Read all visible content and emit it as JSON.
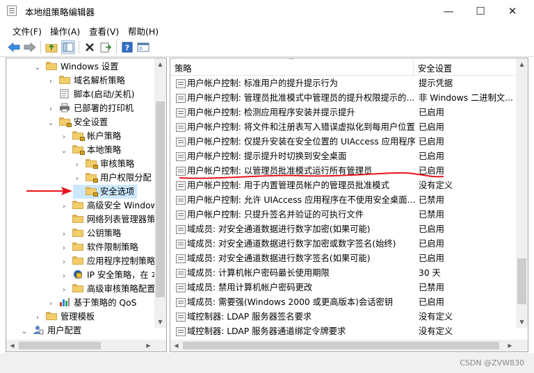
{
  "window": {
    "title": "本地组策略编辑器",
    "min": "—",
    "max": "☐",
    "close": "✕"
  },
  "menu": [
    "文件(F)",
    "操作(A)",
    "查看(V)",
    "帮助(H)"
  ],
  "tree": [
    {
      "label": "Windows 设置",
      "level": 1,
      "toggle": "⌄",
      "icon": "folder"
    },
    {
      "label": "域名解析策略",
      "level": 2,
      "toggle": "›",
      "icon": "folder"
    },
    {
      "label": "脚本(启动/关机)",
      "level": 2,
      "toggle": "",
      "icon": "script"
    },
    {
      "label": "已部署的打印机",
      "level": 2,
      "toggle": "›",
      "icon": "printer"
    },
    {
      "label": "安全设置",
      "level": 2,
      "toggle": "⌄",
      "icon": "folder-lock"
    },
    {
      "label": "帐户策略",
      "level": 3,
      "toggle": "›",
      "icon": "folder-lock"
    },
    {
      "label": "本地策略",
      "level": 3,
      "toggle": "⌄",
      "icon": "folder-lock"
    },
    {
      "label": "审核策略",
      "level": 4,
      "toggle": "›",
      "icon": "folder-lock"
    },
    {
      "label": "用户权限分配",
      "level": 4,
      "toggle": "›",
      "icon": "folder-lock"
    },
    {
      "label": "安全选项",
      "level": 4,
      "toggle": "",
      "icon": "folder-lock",
      "selected": true
    },
    {
      "label": "高级安全 Windows Defender 防火墙",
      "level": 3,
      "toggle": "›",
      "icon": "folder"
    },
    {
      "label": "网络列表管理器策略",
      "level": 3,
      "toggle": "",
      "icon": "folder"
    },
    {
      "label": "公钥策略",
      "level": 3,
      "toggle": "›",
      "icon": "folder"
    },
    {
      "label": "软件限制策略",
      "level": 3,
      "toggle": "›",
      "icon": "folder"
    },
    {
      "label": "应用程序控制策略",
      "level": 3,
      "toggle": "›",
      "icon": "folder"
    },
    {
      "label": "IP 安全策略，在 本地计算机",
      "level": 3,
      "toggle": "›",
      "icon": "ipsec"
    },
    {
      "label": "高级审核策略配置",
      "level": 3,
      "toggle": "›",
      "icon": "folder"
    },
    {
      "label": "基于策略的 QoS",
      "level": 2,
      "toggle": "›",
      "icon": "chart"
    },
    {
      "label": "管理模板",
      "level": 1,
      "toggle": "›",
      "icon": "folder"
    },
    {
      "label": "用户配置",
      "level": 0,
      "toggle": "⌄",
      "icon": "user"
    }
  ],
  "list": {
    "col_policy": "策略",
    "col_setting": "安全设置",
    "rows": [
      {
        "name": "用户帐户控制: 标准用户的提升提示行为",
        "value": "提示凭据"
      },
      {
        "name": "用户帐户控制: 管理员批准模式中管理员的提升权限提示的...",
        "value": "非 Windows 二进制文..."
      },
      {
        "name": "用户帐户控制: 检测应用程序安装并提示提升",
        "value": "已启用"
      },
      {
        "name": "用户帐户控制: 将文件和注册表写入错误虚拟化到每用户位置",
        "value": "已启用"
      },
      {
        "name": "用户帐户控制: 仅提升安装在安全位置的 UIAccess 应用程序",
        "value": "已启用"
      },
      {
        "name": "用户帐户控制: 提示提升时切换到安全桌面",
        "value": "已启用"
      },
      {
        "name": "用户帐户控制: 以管理员批准模式运行所有管理员",
        "value": "已启用"
      },
      {
        "name": "用户帐户控制: 用于内置管理员帐户的管理员批准模式",
        "value": "没有定义"
      },
      {
        "name": "用户帐户控制: 允许 UIAccess 应用程序在不使用安全桌面...",
        "value": "已禁用"
      },
      {
        "name": "用户帐户控制: 只提升签名并验证的可执行文件",
        "value": "已禁用"
      },
      {
        "name": "域成员: 对安全通道数据进行数字加密(如果可能)",
        "value": "已启用"
      },
      {
        "name": "域成员: 对安全通道数据进行数字加密或数字签名(始终)",
        "value": "已启用"
      },
      {
        "name": "域成员: 对安全通道数据进行数字签名(如果可能)",
        "value": "已启用"
      },
      {
        "name": "域成员: 计算机帐户密码最长使用期限",
        "value": "30 天"
      },
      {
        "name": "域成员: 禁用计算机帐户密码更改",
        "value": "已禁用"
      },
      {
        "name": "域成员: 需要强(Windows 2000 或更高版本)会话密钥",
        "value": "已启用"
      },
      {
        "name": "域控制器: LDAP 服务器签名要求",
        "value": "没有定义"
      },
      {
        "name": "域控制器: LDAP 服务器通道绑定令牌要求",
        "value": "没有定义"
      }
    ]
  },
  "watermark": "CSDN @ZVW830",
  "colors": {
    "selection": "#cce8ff",
    "annotation_red": "#e8131a"
  }
}
